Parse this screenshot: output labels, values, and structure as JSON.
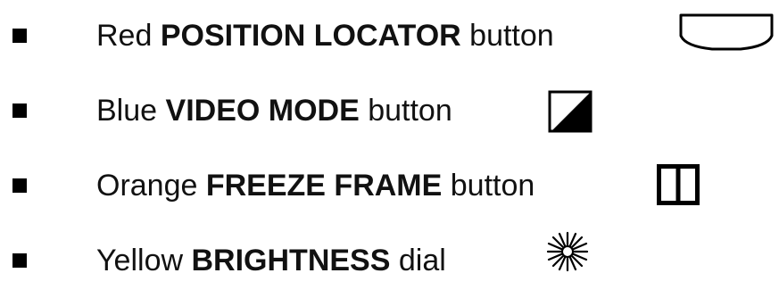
{
  "items": [
    {
      "color_word": "Red",
      "name": "POSITION LOCATOR",
      "control": "button",
      "icon": "position-locator-icon"
    },
    {
      "color_word": "Blue",
      "name": "VIDEO MODE",
      "control": "button",
      "icon": "video-mode-icon"
    },
    {
      "color_word": "Orange",
      "name": "FREEZE FRAME",
      "control": "button",
      "icon": "freeze-frame-icon"
    },
    {
      "color_word": "Yellow",
      "name": "BRIGHTNESS",
      "control": "dial",
      "icon": "brightness-icon"
    }
  ]
}
